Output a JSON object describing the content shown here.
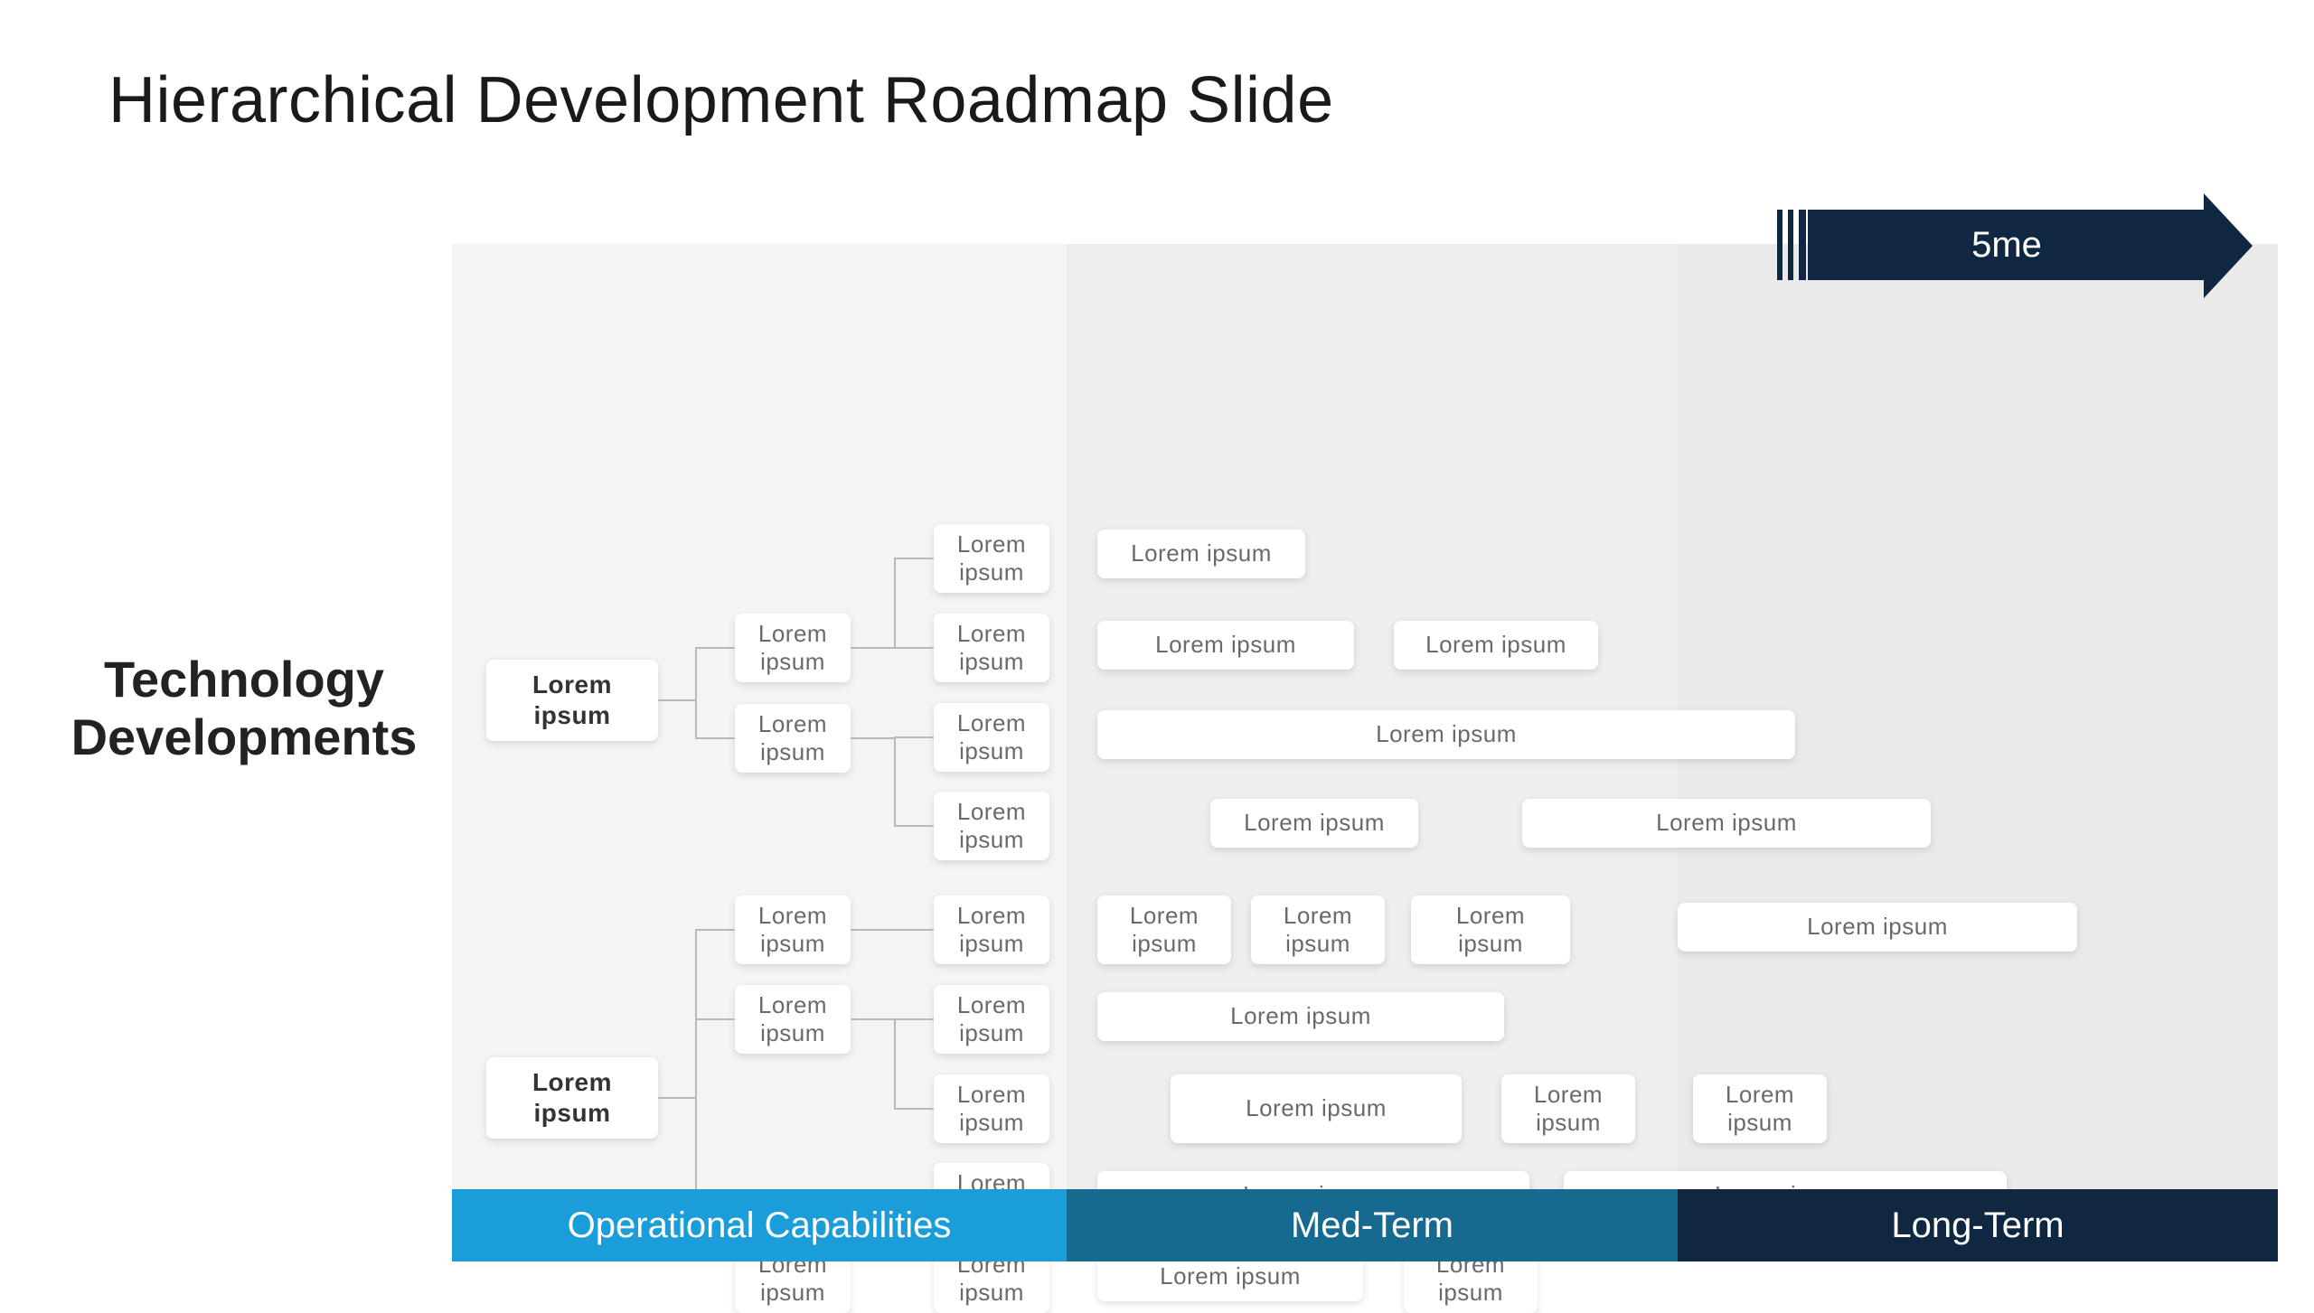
{
  "title": "Hierarchical Development Roadmap Slide",
  "side_label": "Technology Developments",
  "arrow_label": "5me",
  "axis": {
    "col1": "Operational Capabilities",
    "col2": "Med-Term",
    "col3": "Long-Term"
  },
  "generic": "Lorem ipsum"
}
